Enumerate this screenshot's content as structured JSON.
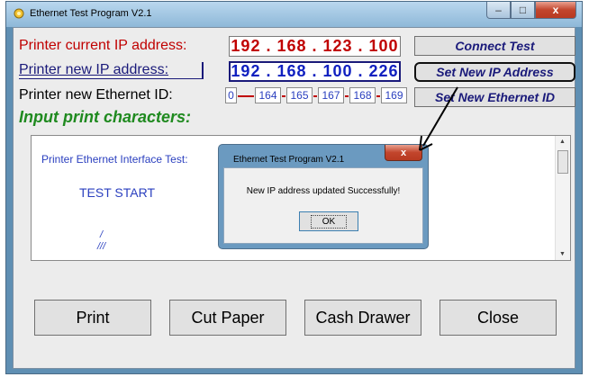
{
  "window": {
    "title": "Ethernet Test Program  V2.1",
    "min_glyph": "–",
    "max_glyph": "□",
    "close_glyph": "x"
  },
  "form": {
    "current_ip_label": "Printer current IP address:",
    "current_ip_value": "192 . 168 . 123 . 100",
    "new_ip_label": "Printer new IP address:",
    "new_ip_value": "192 . 168 . 100 . 226",
    "ethernet_id_label": "Printer new Ethernet ID:",
    "ethernet_id_values": [
      "0",
      "164",
      "165",
      "167",
      "168",
      "169"
    ],
    "input_heading": "Input print characters:"
  },
  "buttons": {
    "connect_test": "Connect Test",
    "set_new_ip": "Set New IP Address",
    "set_new_ethernet": "Set New Ethernet ID",
    "print": "Print",
    "cut_paper": "Cut Paper",
    "cash_drawer": "Cash Drawer",
    "close": "Close"
  },
  "textarea": {
    "line1": "Printer Ethernet Interface Test:",
    "line2": "TEST  START",
    "line3": "/",
    "line4": "///"
  },
  "dialog": {
    "title": "Ethernet Test Program  V2.1",
    "close_glyph": "x",
    "message": "New IP address updated Successfully!",
    "ok_label": "OK"
  },
  "colors": {
    "red": "#c00000",
    "blue": "#1020c0",
    "green": "#1f8a1f",
    "dark_blue": "#1a1a7a",
    "text_blue": "#2a3fbf"
  }
}
